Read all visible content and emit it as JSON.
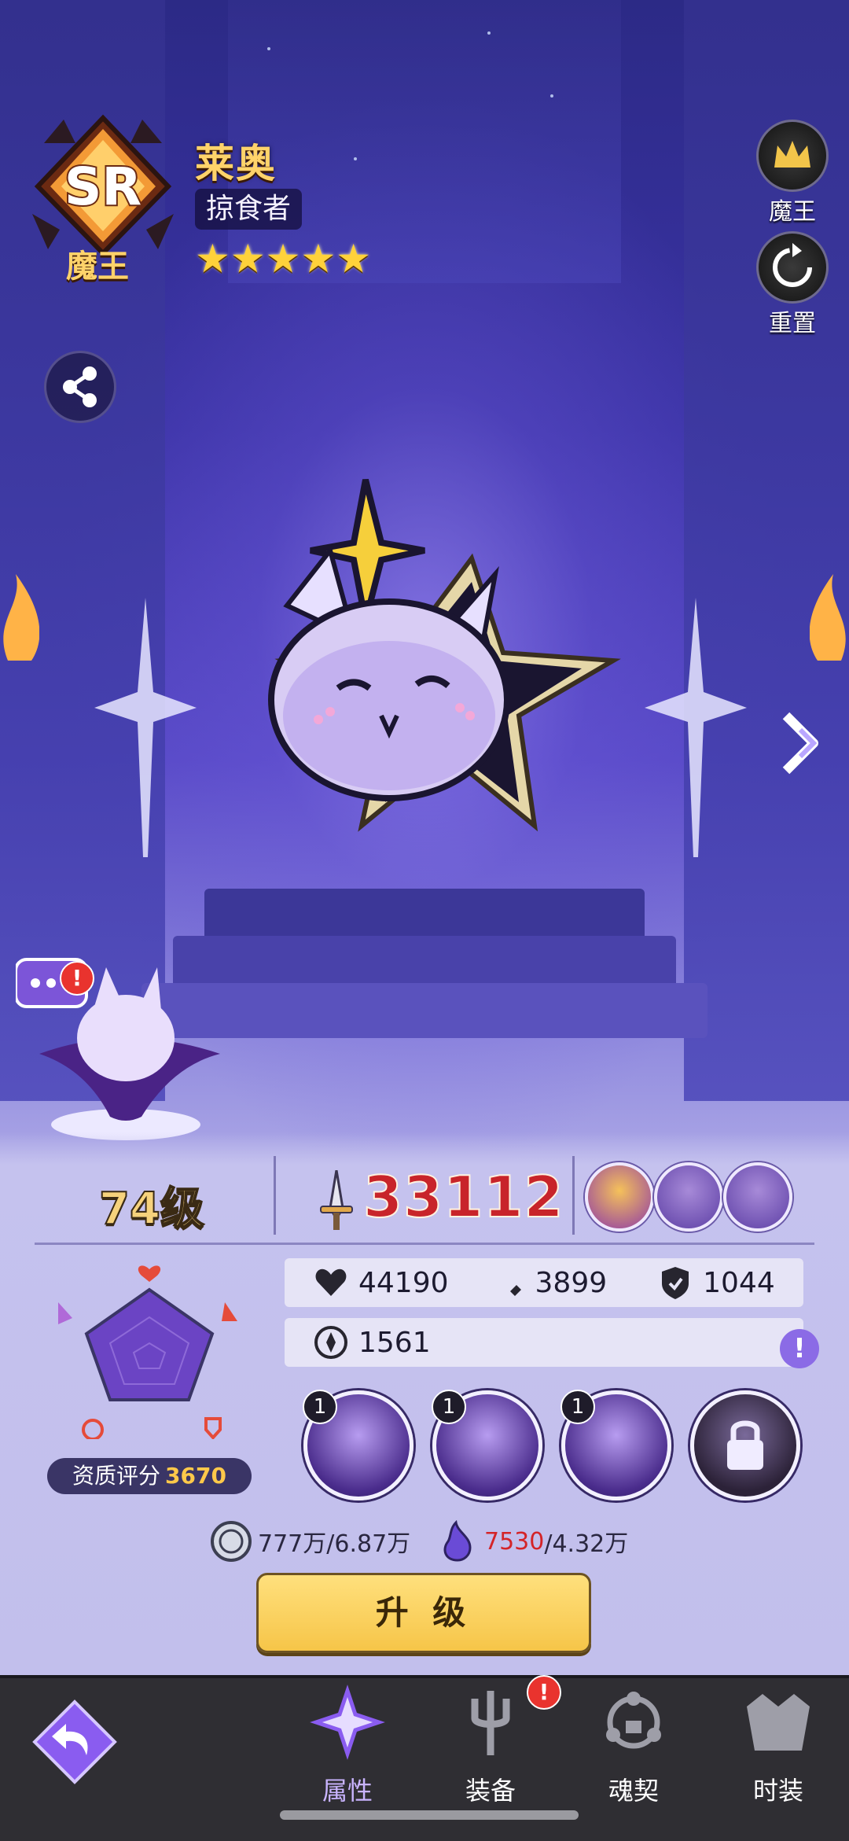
{
  "header": {
    "rank": "SR",
    "rank_label": "魔王",
    "name": "莱奥",
    "title": "掠食者",
    "stars": "★★★★★"
  },
  "side_buttons": {
    "demon_king": "魔王",
    "reset": "重置"
  },
  "stats": {
    "level": "74级",
    "power": "33112",
    "hp": "44190",
    "attack": "3899",
    "defense": "1044",
    "speed": "1561",
    "quality_label": "资质评分",
    "quality_value": "3670"
  },
  "skills": [
    {
      "level": "1"
    },
    {
      "level": "1"
    },
    {
      "level": "1"
    }
  ],
  "costs": {
    "coin": "777万/6.87万",
    "soul_have": "7530",
    "soul_need": "/4.32万"
  },
  "upgrade_label": "升 级",
  "tabs": [
    {
      "label": "属性"
    },
    {
      "label": "装备"
    },
    {
      "label": "魂契"
    },
    {
      "label": "时装"
    }
  ],
  "colors": {
    "accent": "#c9b4ff",
    "power": "#c8242a",
    "button": "#f6c548"
  }
}
